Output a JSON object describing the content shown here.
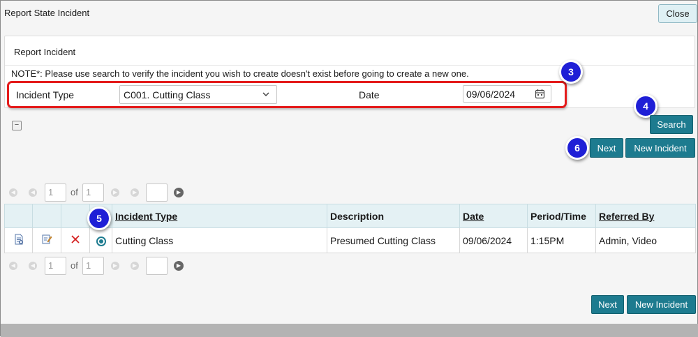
{
  "window": {
    "title": "Report State Incident",
    "close_label": "Close"
  },
  "panel": {
    "title": "Report Incident",
    "note": "NOTE*: Please use search to verify the incident you wish to create doesn't exist before going to create a new one."
  },
  "form": {
    "incident_type_label": "Incident Type",
    "incident_type_value": "C001. Cutting Class",
    "date_label": "Date",
    "date_value": "09/06/2024"
  },
  "markers": {
    "m3": "3",
    "m4": "4",
    "m5": "5",
    "m6": "6"
  },
  "toolbar": {
    "collapse_label": "−",
    "search_label": "Search",
    "next_label": "Next",
    "new_incident_label": "New Incident"
  },
  "pager": {
    "page": "1",
    "of_label": "of",
    "total": "1",
    "go_value": ""
  },
  "table": {
    "columns": [
      "Incident Type",
      "Description",
      "Date",
      "Period/Time",
      "Referred By"
    ],
    "rows": [
      {
        "incident_type": "Cutting Class",
        "description": "Presumed Cutting Class",
        "date": "09/06/2024",
        "period_time": "1:15PM",
        "referred_by": "Admin, Video"
      }
    ]
  },
  "colors": {
    "accent": "#1d7b8f",
    "marker": "#1f1fd6",
    "highlight": "#e41b1b"
  }
}
